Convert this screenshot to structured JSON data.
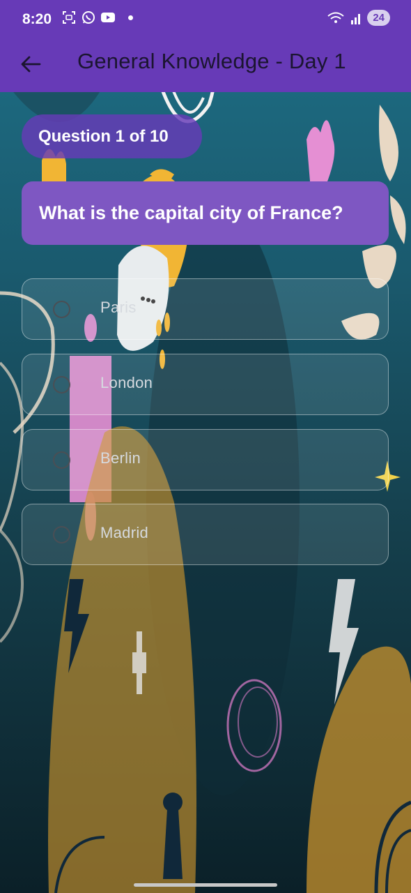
{
  "status_bar": {
    "time": "8:20",
    "battery_level": "24",
    "icons_left": [
      "screenshot-icon",
      "whatsapp-icon",
      "youtube-icon",
      "notification-dot"
    ],
    "icons_right": [
      "wifi-icon",
      "signal-icon",
      "battery-icon"
    ]
  },
  "app_bar": {
    "title": "General Knowledge - Day 1",
    "back_icon": "arrow-left-icon",
    "color": "#673ab7"
  },
  "quiz": {
    "counter": "Question 1 of 10",
    "question": "What is the capital city of France?",
    "options": [
      {
        "label": "Paris",
        "selected": false
      },
      {
        "label": "London",
        "selected": false
      },
      {
        "label": "Berlin",
        "selected": false
      },
      {
        "label": "Madrid",
        "selected": false
      }
    ]
  },
  "colors": {
    "accent": "#7e57c2",
    "counter_pill": "#673ab7",
    "background_top": "#1e6f86",
    "background_bottom": "#0b2028"
  }
}
